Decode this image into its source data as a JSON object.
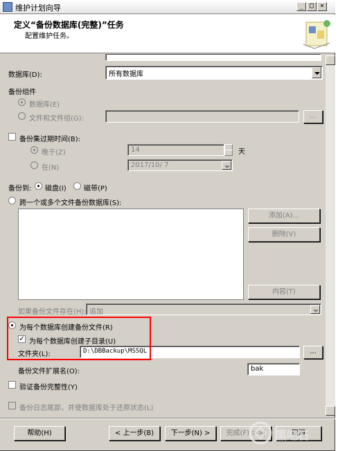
{
  "window": {
    "title": "维护计划向导",
    "header_title": "定义“备份数据库(完整)”任务",
    "header_subtitle": "配置维护任务。"
  },
  "form": {
    "database_label": "数据库(D):",
    "database_value": "所有数据库",
    "backup_component_label": "备份组件",
    "radio_database": "数据库(E)",
    "radio_files": "文件和文件组(G):",
    "files_browse": "...",
    "backup_expire_label": "备份集过期时间(B):",
    "radio_after": "晚于(Z)",
    "after_value": "14",
    "days_unit": "天",
    "radio_on": "在(N)",
    "on_value": "2017/10/ 7",
    "backup_to_label": "备份到:",
    "radio_disk": "磁盘(I)",
    "radio_tape": "磁带(P)",
    "radio_span": "跨一个或多个文件备份数据库(S):",
    "btn_add": "添加(A)...",
    "btn_remove": "删除(V)",
    "btn_content": "内容(T)",
    "if_exists_label": "如果备份文件存在(H):",
    "if_exists_value": "追加",
    "radio_per_db": "为每个数据库创建备份文件(R)",
    "check_subdir": "为每个数据库创建子目录(U)",
    "folder_label": "文件夹(L):",
    "folder_value": "D:\\DBBackup\\MSSQL",
    "folder_browse": "...",
    "ext_label": "备份文件扩展名(O):",
    "ext_value": "bak",
    "check_verify": "验证备份完整性(Y)",
    "check_tail": "备份日志尾部，并使数据库处于还原状态(L)"
  },
  "footer": {
    "help": "帮助(H)",
    "back": "< 上一步(B)",
    "next": "下一步(N) >",
    "finish": "完成(F) >>|",
    "cancel": "取消"
  },
  "watermark": {
    "text": "黑吧石"
  }
}
